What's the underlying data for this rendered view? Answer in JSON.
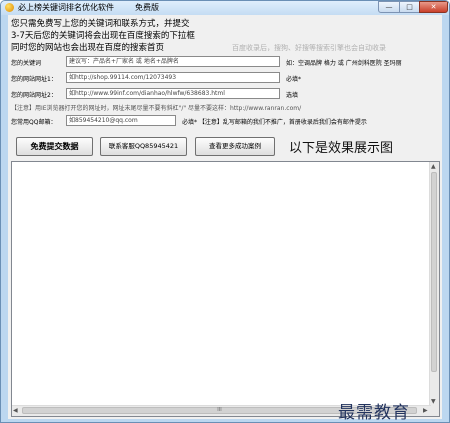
{
  "window": {
    "title": "必上榜关键词排名优化软件",
    "subtitle": "免费版",
    "min_glyph": "—",
    "max_glyph": "□",
    "close_glyph": "✕"
  },
  "intro": {
    "line1": "您只需免费写上您的关键词和联系方式，并提交",
    "line2": "3-7天后您的关键词将会出现在百度搜索的下拉框",
    "line3": "同时您的网站也会出现在百度的搜索首页",
    "faded": "百度收录后，搜狗、好搜等搜索引擎也会自动收录"
  },
  "form": {
    "keyword_label": "您的关键词",
    "keyword_placeholder": "建议写：产品名+厂家名  或  地名+品牌名",
    "keyword_hint": "如：空调品牌 格力  或 广州剑科医院 圣玛丽",
    "url1_label": "您的网站网址1：",
    "url1_value": "如http://shop.99114.com/12073493",
    "url1_hint": "必填*",
    "url2_label": "您的网站网址2：",
    "url2_value": "如http://www.99inf.com/dianhao/hlwfw/638683.html",
    "url2_hint": "选填",
    "url_note": "【注意】用IE浏览器打开您的网址时，网址末尾尽量不要有斜杠\"/\" 尽量不要这样：http://www.ranran.com/",
    "email_label": "您常用QQ邮箱：",
    "email_value": "如859454210@qq.com",
    "email_hint": "必填* 【注意】乱写邮箱的我们不推广，首册收录后我们会有邮件提示"
  },
  "buttons": {
    "submit": "免费提交数据",
    "contact": "联系客服QQ85945421",
    "cases": "查看更多成功案例"
  },
  "showcase": {
    "title": "以下是效果展示图"
  },
  "scrollbar": {
    "up": "▲",
    "down": "▼",
    "left": "◀",
    "right": "▶",
    "grip": "III"
  },
  "watermark": "最需教育"
}
